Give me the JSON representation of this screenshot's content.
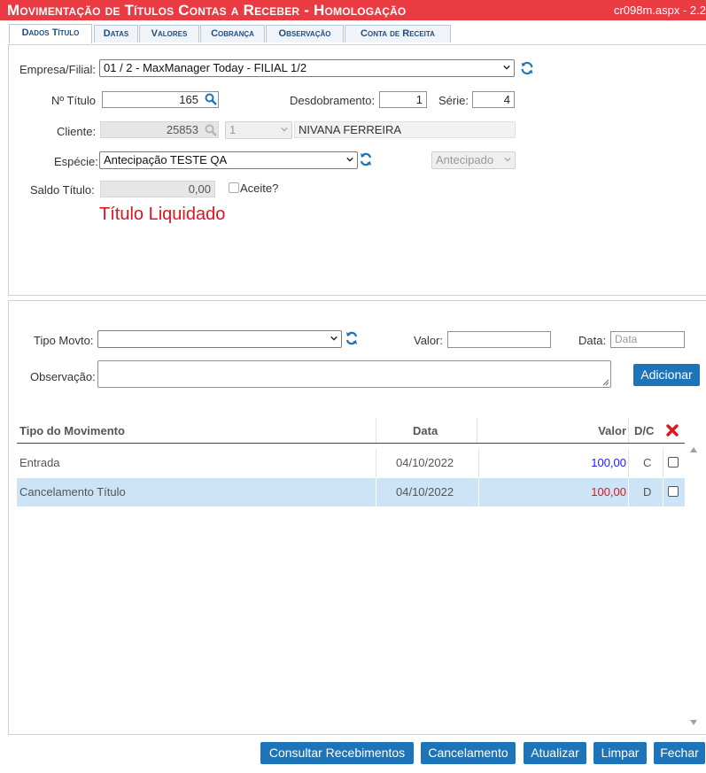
{
  "header": {
    "title": "Movimentação de Títulos Contas a Receber  - Homologação",
    "page_ref": "cr098m.aspx - 2.2"
  },
  "tabs": [
    {
      "label": "Dados Título",
      "active": true
    },
    {
      "label": "Datas"
    },
    {
      "label": "Valores"
    },
    {
      "label": "Cobrança"
    },
    {
      "label": "Observação"
    },
    {
      "label": "Conta de Receita"
    }
  ],
  "form": {
    "empresa_label": "Empresa/Filial:",
    "empresa_value": "01 / 2 - MaxManager Today - FILIAL 1/2",
    "titulo_label": "Nº Título",
    "titulo_value": "165",
    "desdobramento_label": "Desdobramento:",
    "desdobramento_value": "1",
    "serie_label": "Série:",
    "serie_value": "4",
    "cliente_label": "Cliente:",
    "cliente_code": "25853",
    "cliente_seq": "1",
    "cliente_name": "NIVANA FERREIRA",
    "especie_label": "Espécie:",
    "especie_value": "Antecipação TESTE QA",
    "especie_status": "Antecipado",
    "saldo_label": "Saldo Título:",
    "saldo_value": "0,00",
    "aceite_label": "Aceite?",
    "status_message": "Título Liquidado"
  },
  "movto": {
    "tipo_label": "Tipo Movto:",
    "tipo_value": "",
    "valor_label": "Valor:",
    "valor_value": "",
    "data_label": "Data:",
    "data_placeholder": "Data",
    "obs_label": "Observação:",
    "add_button": "Adicionar"
  },
  "grid": {
    "columns": [
      "Tipo do Movimento",
      "Data",
      "Valor",
      "D/C"
    ],
    "rows": [
      {
        "tipo": "Entrada",
        "data": "04/10/2022",
        "valor": "100,00",
        "dc": "C"
      },
      {
        "tipo": "Cancelamento Título",
        "data": "04/10/2022",
        "valor": "100,00",
        "dc": "D"
      }
    ]
  },
  "colors": {
    "header_bg": "#ea3b43",
    "accent": "#1e74b8",
    "credit": "#1a1aff",
    "debit": "#e0141e",
    "row_selected": "#cce4f5"
  },
  "footer": {
    "buttons": [
      "Consultar Recebimentos",
      "Cancelamento",
      "Atualizar",
      "Limpar",
      "Fechar"
    ]
  }
}
